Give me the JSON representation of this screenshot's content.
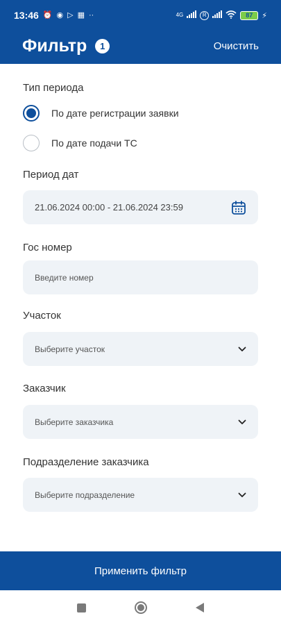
{
  "status_bar": {
    "time": "13:46",
    "network": "4G",
    "battery": "87"
  },
  "header": {
    "title": "Фильтр",
    "badge_count": "1",
    "clear_label": "Очистить"
  },
  "period_type": {
    "label": "Тип периода",
    "options": [
      {
        "label": "По дате регистрации заявки",
        "checked": true
      },
      {
        "label": "По дате подачи ТС",
        "checked": false
      }
    ]
  },
  "date_range": {
    "label": "Период дат",
    "value": "21.06.2024 00:00 - 21.06.2024 23:59",
    "icon": "calendar-icon"
  },
  "plate": {
    "label": "Гос номер",
    "placeholder": "Введите номер"
  },
  "section": {
    "label": "Участок",
    "placeholder": "Выберите участок"
  },
  "customer": {
    "label": "Заказчик",
    "placeholder": "Выберите заказчика"
  },
  "customer_division": {
    "label": "Подразделение заказчика",
    "placeholder": "Выберите подразделение"
  },
  "apply_label": "Применить фильтр",
  "colors": {
    "primary": "#0e4f9c",
    "field_bg": "#eff3f7",
    "battery": "#7ccc4a"
  }
}
